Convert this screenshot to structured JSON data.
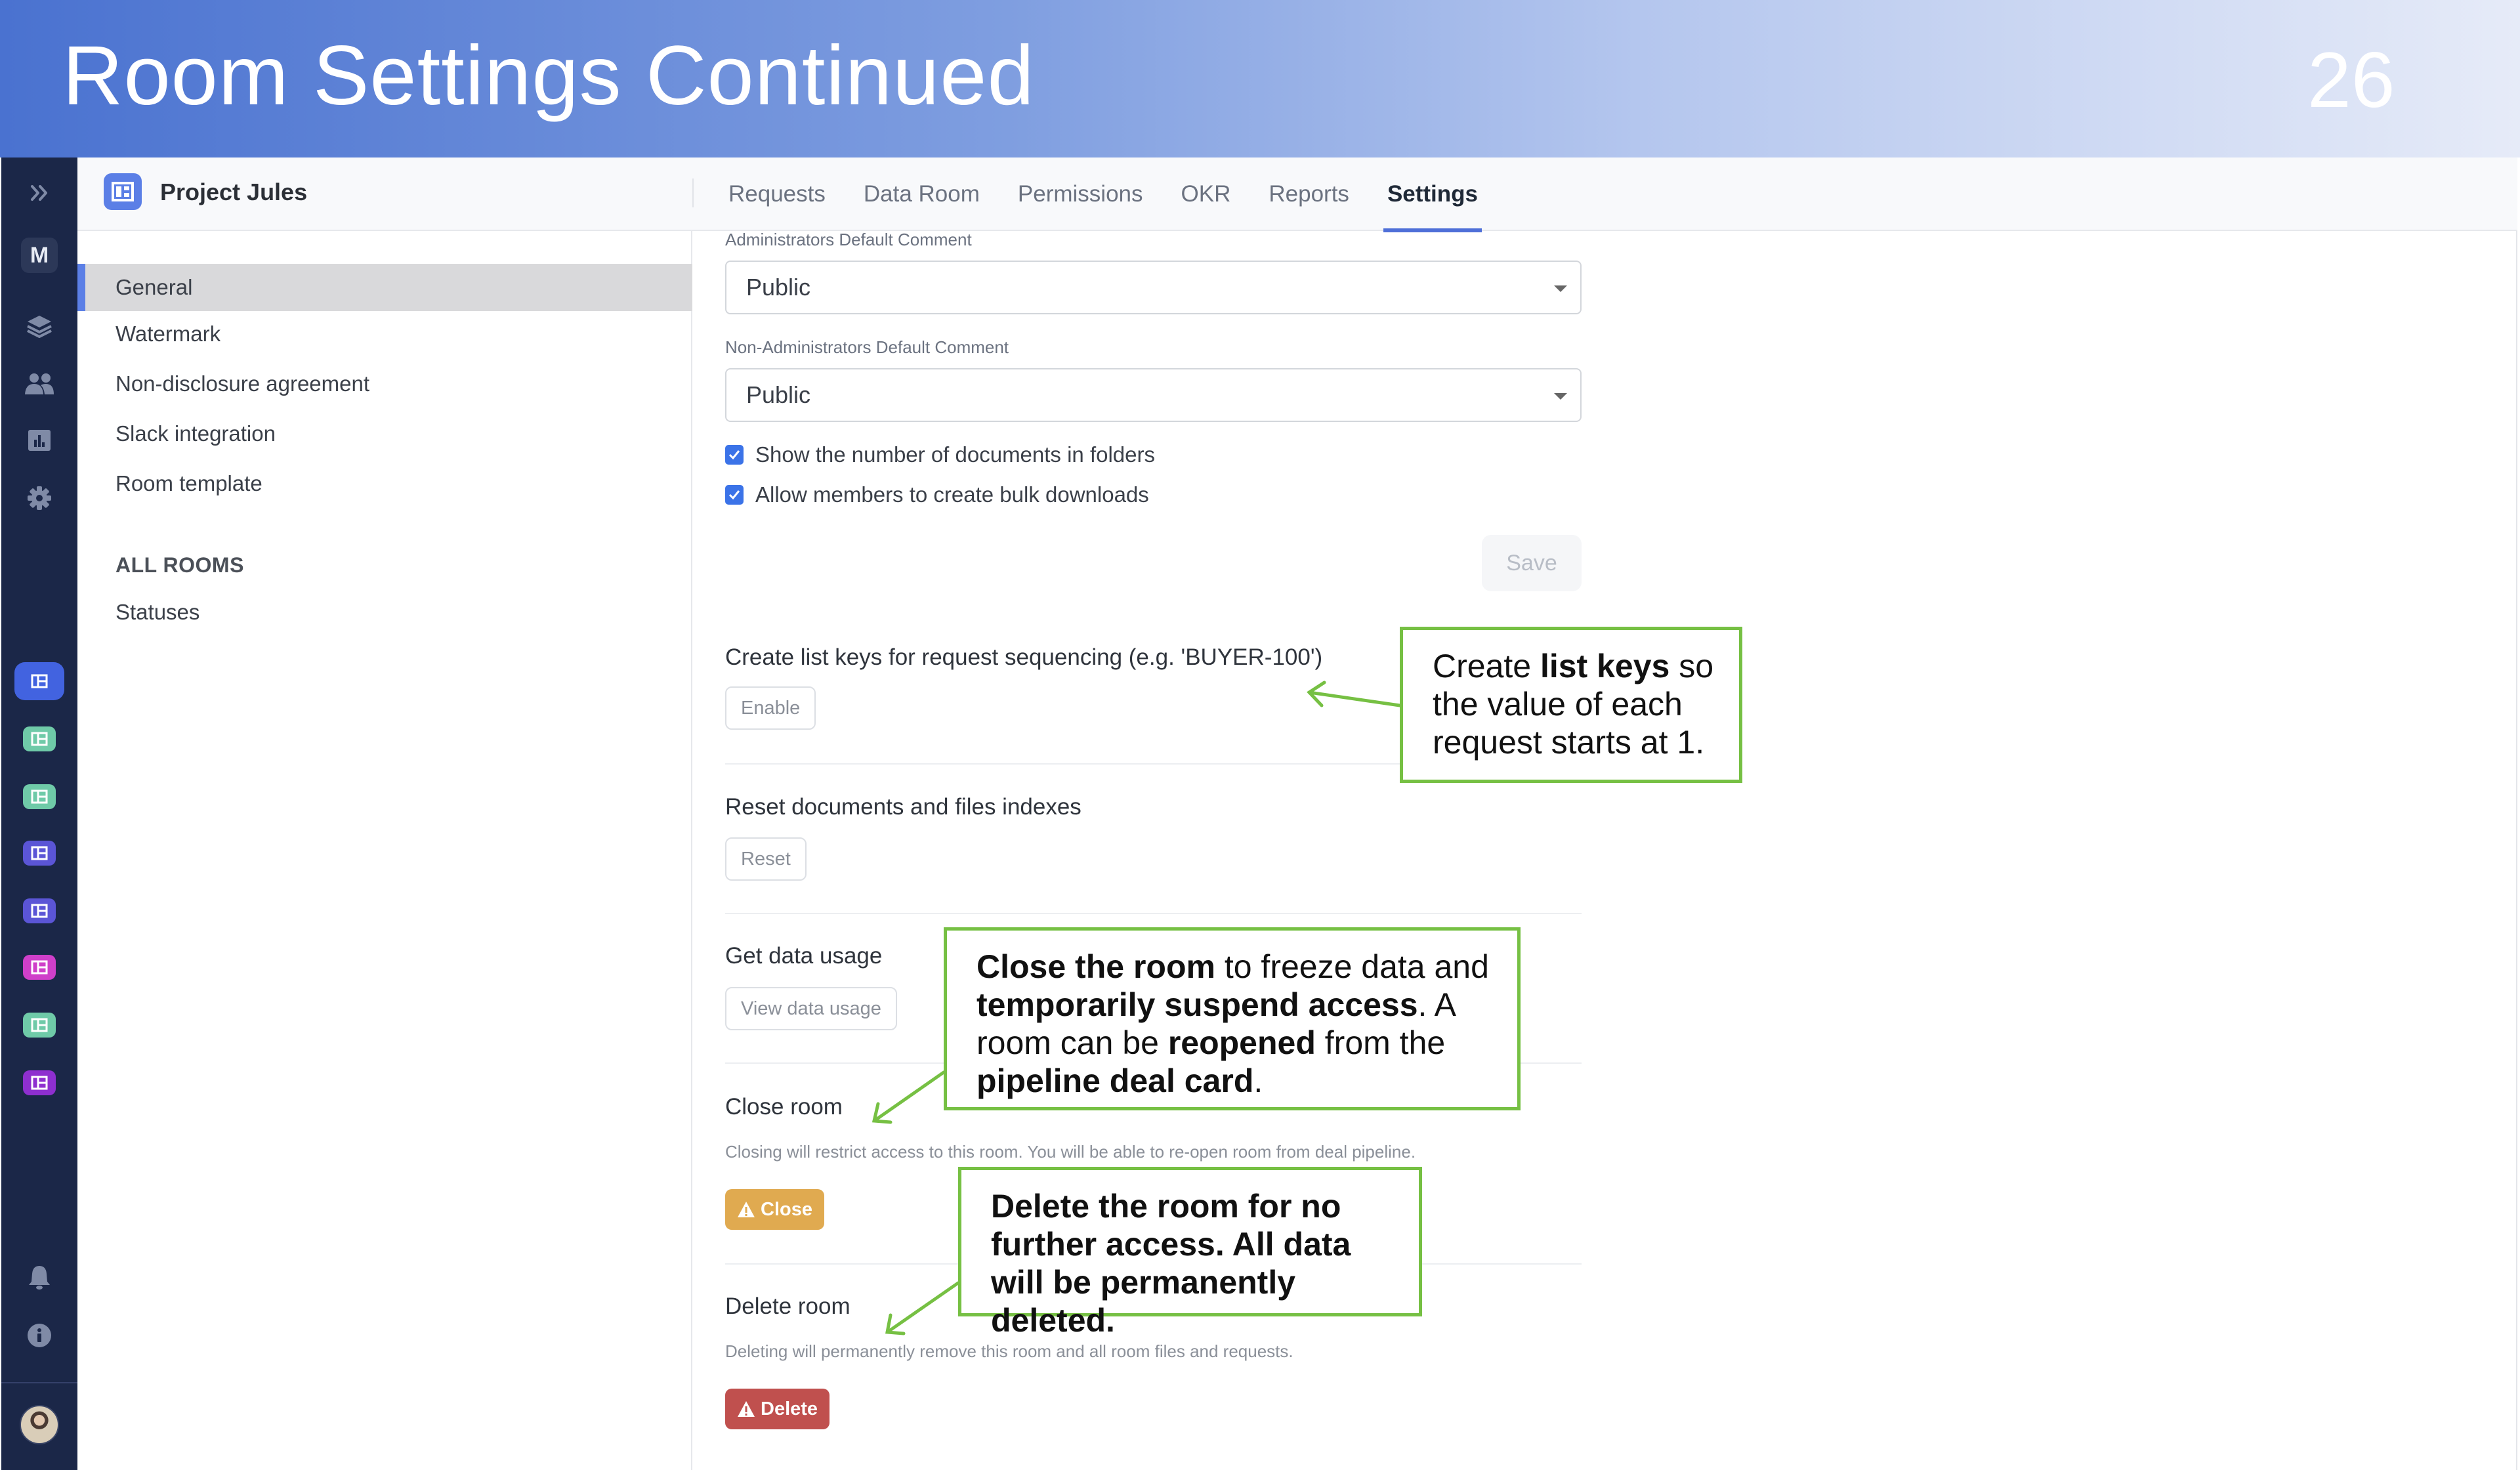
{
  "slide": {
    "title": "Room Settings Continued",
    "page_number": "26"
  },
  "rail": {
    "expand_icon": "double-chevron-right-icon",
    "workspace_initial": "M",
    "nav_icons": [
      "layers-icon",
      "users-icon",
      "chart-icon",
      "gear-icon"
    ],
    "rooms": [
      {
        "color": "#4263e0",
        "active": true
      },
      {
        "color": "#6fcaa8",
        "active": false
      },
      {
        "color": "#6fcaa8",
        "active": false
      },
      {
        "color": "#5b55d6",
        "active": false
      },
      {
        "color": "#5b55d6",
        "active": false
      },
      {
        "color": "#cf3fc9",
        "active": false
      },
      {
        "color": "#6fcaa8",
        "active": false
      },
      {
        "color": "#8e2fcf",
        "active": false
      }
    ],
    "bottom_icons": [
      "bell-icon",
      "info-icon"
    ]
  },
  "topbar": {
    "project_name": "Project Jules",
    "tabs": [
      {
        "label": "Requests",
        "active": false
      },
      {
        "label": "Data Room",
        "active": false
      },
      {
        "label": "Permissions",
        "active": false
      },
      {
        "label": "OKR",
        "active": false
      },
      {
        "label": "Reports",
        "active": false
      },
      {
        "label": "Settings",
        "active": true
      }
    ]
  },
  "settings_nav": {
    "items": [
      {
        "label": "General",
        "active": true
      },
      {
        "label": "Watermark",
        "active": false
      },
      {
        "label": "Non-disclosure agreement",
        "active": false
      },
      {
        "label": "Slack integration",
        "active": false
      },
      {
        "label": "Room template",
        "active": false
      }
    ],
    "all_rooms_heading": "ALL ROOMS",
    "all_rooms_items": [
      {
        "label": "Statuses"
      }
    ]
  },
  "general": {
    "admin_comment_label": "Administrators Default Comment",
    "admin_comment_value": "Public",
    "nonadmin_comment_label": "Non-Administrators Default Comment",
    "nonadmin_comment_value": "Public",
    "checkboxes": [
      {
        "label": "Show the number of documents in folders",
        "checked": true
      },
      {
        "label": "Allow members to create bulk downloads",
        "checked": true
      }
    ],
    "save_label": "Save"
  },
  "sections": {
    "list_keys": {
      "title": "Create list keys for request sequencing (e.g. 'BUYER-100')",
      "button": "Enable"
    },
    "reset": {
      "title": "Reset documents and files indexes",
      "button": "Reset"
    },
    "data_usage": {
      "title": "Get data usage",
      "button": "View data usage"
    },
    "close_room": {
      "title": "Close room",
      "description": "Closing will restrict access to this room. You will be able to re-open room from deal pipeline.",
      "button": "Close",
      "button_color": "#e0aa50"
    },
    "delete_room": {
      "title": "Delete room",
      "description": "Deleting will permanently remove this room and all room files and requests.",
      "button": "Delete",
      "button_color": "#c0504e"
    }
  },
  "callouts": {
    "list_keys": [
      {
        "text": "Create ",
        "bold": false
      },
      {
        "text": "list keys",
        "bold": true
      },
      {
        "text": " so the value of each request starts at 1.",
        "bold": false
      }
    ],
    "close_room": [
      {
        "text": "Close the room",
        "bold": true
      },
      {
        "text": " to freeze data and ",
        "bold": false
      },
      {
        "text": "temporarily suspend access",
        "bold": true
      },
      {
        "text": ". A room can be ",
        "bold": false
      },
      {
        "text": "reopened",
        "bold": true
      },
      {
        "text": " from the ",
        "bold": false
      },
      {
        "text": "pipeline deal card",
        "bold": true
      },
      {
        "text": ".",
        "bold": false
      }
    ],
    "delete_room": [
      {
        "text": "Delete the room for no further access. All data will be permanently deleted.",
        "bold": true
      }
    ],
    "border_color": "#76c043"
  }
}
